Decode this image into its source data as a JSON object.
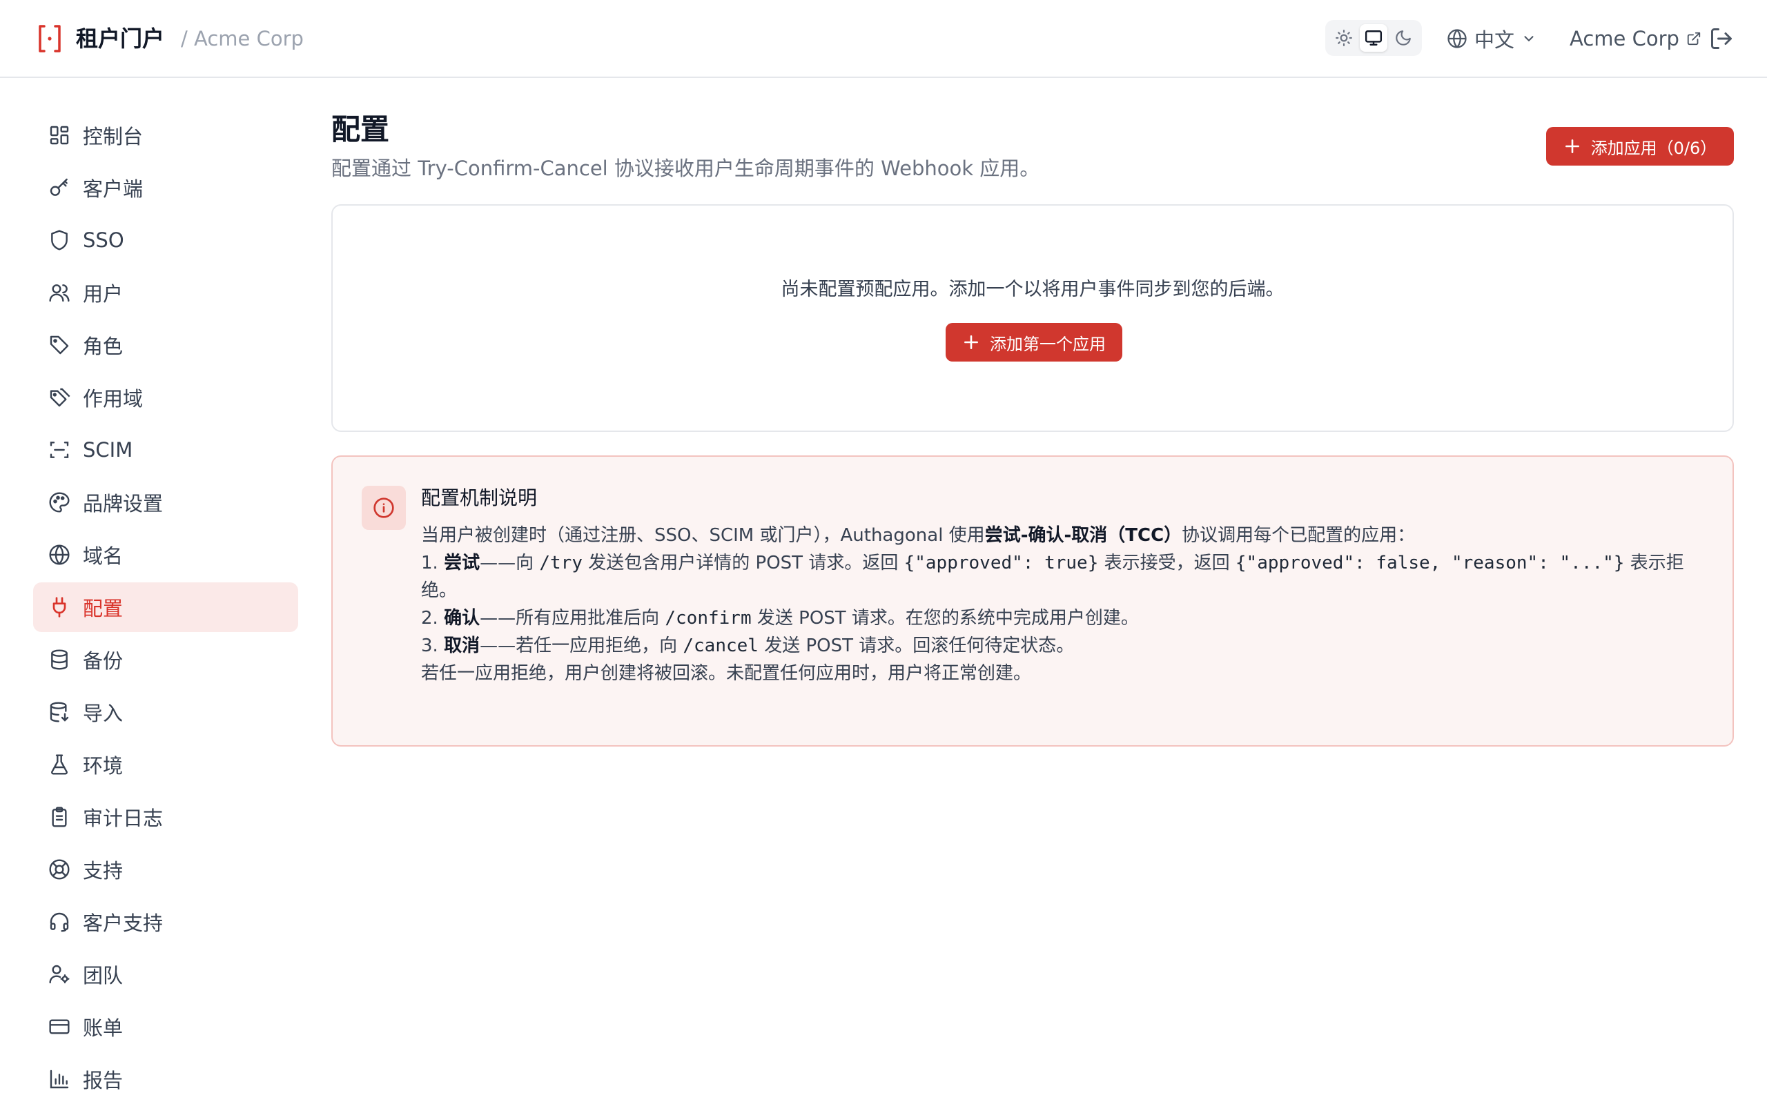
{
  "header": {
    "app_title": "租户门户",
    "breadcrumb": "/ Acme Corp",
    "language": "中文",
    "tenant_link": "Acme Corp",
    "theme_options": [
      "light",
      "system",
      "dark"
    ],
    "theme_selected": "system"
  },
  "sidebar": {
    "items": [
      {
        "label": "控制台",
        "icon": "dashboard-icon"
      },
      {
        "label": "客户端",
        "icon": "key-icon"
      },
      {
        "label": "SSO",
        "icon": "shield-icon"
      },
      {
        "label": "用户",
        "icon": "users-icon"
      },
      {
        "label": "角色",
        "icon": "tag-icon"
      },
      {
        "label": "作用域",
        "icon": "tags-icon"
      },
      {
        "label": "SCIM",
        "icon": "scan-icon"
      },
      {
        "label": "品牌设置",
        "icon": "palette-icon"
      },
      {
        "label": "域名",
        "icon": "globe-icon"
      },
      {
        "label": "配置",
        "icon": "plug-icon"
      },
      {
        "label": "备份",
        "icon": "database-icon"
      },
      {
        "label": "导入",
        "icon": "database-import-icon"
      },
      {
        "label": "环境",
        "icon": "flask-icon"
      },
      {
        "label": "审计日志",
        "icon": "clipboard-icon"
      },
      {
        "label": "支持",
        "icon": "lifebuoy-icon"
      },
      {
        "label": "客户支持",
        "icon": "headset-icon"
      },
      {
        "label": "团队",
        "icon": "user-cog-icon"
      },
      {
        "label": "账单",
        "icon": "credit-card-icon"
      },
      {
        "label": "报告",
        "icon": "bar-chart-icon"
      }
    ],
    "active": "配置"
  },
  "main": {
    "title": "配置",
    "subtitle": "配置通过 Try-Confirm-Cancel 协议接收用户生命周期事件的 Webhook 应用。",
    "add_button": "添加应用（0/6）",
    "empty": {
      "message": "尚未配置预配应用。添加一个以将用户事件同步到您的后端。",
      "button": "添加第一个应用"
    },
    "info": {
      "title": "配置机制说明",
      "intro_prefix": "当用户被创建时（通过注册、SSO、SCIM 或门户），Authagonal 使用",
      "intro_bold": "尝试-确认-取消（TCC）",
      "intro_suffix": "协议调用每个已配置的应用：",
      "step1_num": "1.",
      "step1_bold": "尝试",
      "step1_a": "——向",
      "step1_code1": "/try",
      "step1_b": "发送包含用户详情的 POST 请求。返回",
      "step1_code2": "{\"approved\": true}",
      "step1_c": "表示接受，返回",
      "step1_code3": "{\"approved\": false, \"reason\": \"...\"}",
      "step1_d": "表示拒绝。",
      "step2_num": "2.",
      "step2_bold": "确认",
      "step2_a": "——所有应用批准后向",
      "step2_code": "/confirm",
      "step2_b": "发送 POST 请求。在您的系统中完成用户创建。",
      "step3_num": "3.",
      "step3_bold": "取消",
      "step3_a": "——若任一应用拒绝，向",
      "step3_code": "/cancel",
      "step3_b": "发送 POST 请求。回滚任何待定状态。",
      "footer": "若任一应用拒绝，用户创建将被回滚。未配置任何应用时，用户将正常创建。"
    }
  },
  "colors": {
    "accent": "#d0372e",
    "active_bg": "#fbe9e8",
    "info_bg": "#fcf4f3",
    "info_border": "#f3c3bf"
  }
}
